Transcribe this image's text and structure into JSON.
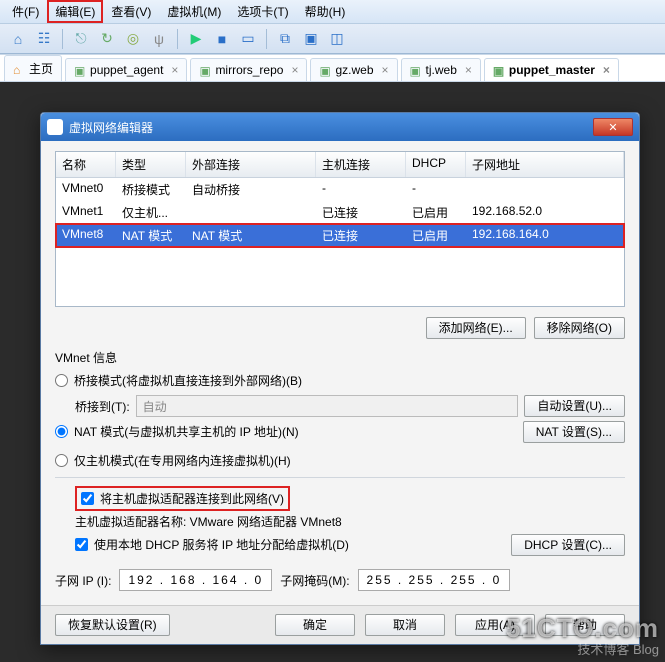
{
  "menubar": {
    "items": [
      {
        "label": "件(F)"
      },
      {
        "label": "编辑(E)",
        "highlight": true
      },
      {
        "label": "查看(V)"
      },
      {
        "label": "虚拟机(M)"
      },
      {
        "label": "选项卡(T)"
      },
      {
        "label": "帮助(H)"
      }
    ]
  },
  "toolbar_icons": [
    "home-icon",
    "sitemap-icon",
    "link-icon",
    "refresh-icon",
    "cd-icon",
    "usb-icon",
    "sep",
    "play-icon",
    "stop-icon",
    "pause-icon",
    "sep",
    "snapshot-icon",
    "fullscreen-icon",
    "unity-icon"
  ],
  "tabs": [
    {
      "label": "主页",
      "closable": false,
      "active": false
    },
    {
      "label": "puppet_agent",
      "closable": true,
      "active": false
    },
    {
      "label": "mirrors_repo",
      "closable": true,
      "active": false
    },
    {
      "label": "gz.web",
      "closable": true,
      "active": false
    },
    {
      "label": "tj.web",
      "closable": true,
      "active": false
    },
    {
      "label": "puppet_master",
      "closable": true,
      "active": true
    }
  ],
  "dialog": {
    "title": "虚拟网络编辑器",
    "columns": [
      "名称",
      "类型",
      "外部连接",
      "主机连接",
      "DHCP",
      "子网地址"
    ],
    "rows": [
      {
        "name": "VMnet0",
        "type": "桥接模式",
        "ext": "自动桥接",
        "host": "-",
        "dhcp": "-",
        "subnet": ""
      },
      {
        "name": "VMnet1",
        "type": "仅主机...",
        "ext": "",
        "host": "已连接",
        "dhcp": "已启用",
        "subnet": "192.168.52.0"
      },
      {
        "name": "VMnet8",
        "type": "NAT 模式",
        "ext": "NAT 模式",
        "host": "已连接",
        "dhcp": "已启用",
        "subnet": "192.168.164.0",
        "selected": true,
        "redbox": true
      }
    ],
    "btn_add": "添加网络(E)...",
    "btn_remove": "移除网络(O)",
    "info_title": "VMnet 信息",
    "radio_bridge": "桥接模式(将虚拟机直接连接到外部网络)(B)",
    "bridge_to_label": "桥接到(T):",
    "bridge_combo": "自动",
    "btn_autoset": "自动设置(U)...",
    "radio_nat": "NAT 模式(与虚拟机共享主机的 IP 地址)(N)",
    "btn_nat": "NAT 设置(S)...",
    "radio_host": "仅主机模式(在专用网络内连接虚拟机)(H)",
    "chk_connect": "将主机虚拟适配器连接到此网络(V)",
    "adapter_name": "主机虚拟适配器名称: VMware 网络适配器 VMnet8",
    "chk_dhcp": "使用本地 DHCP 服务将 IP 地址分配给虚拟机(D)",
    "btn_dhcp": "DHCP 设置(C)...",
    "subnet_ip_label": "子网 IP (I):",
    "subnet_ip": "192 . 168 . 164 .  0",
    "mask_label": "子网掩码(M):",
    "mask": "255 . 255 . 255 .  0",
    "btn_restore": "恢复默认设置(R)",
    "btn_ok": "确定",
    "btn_cancel": "取消",
    "btn_apply": "应用(A)",
    "btn_help": "帮助"
  },
  "watermark": "51CTO.com",
  "watermark2": "技术博客  Blog"
}
